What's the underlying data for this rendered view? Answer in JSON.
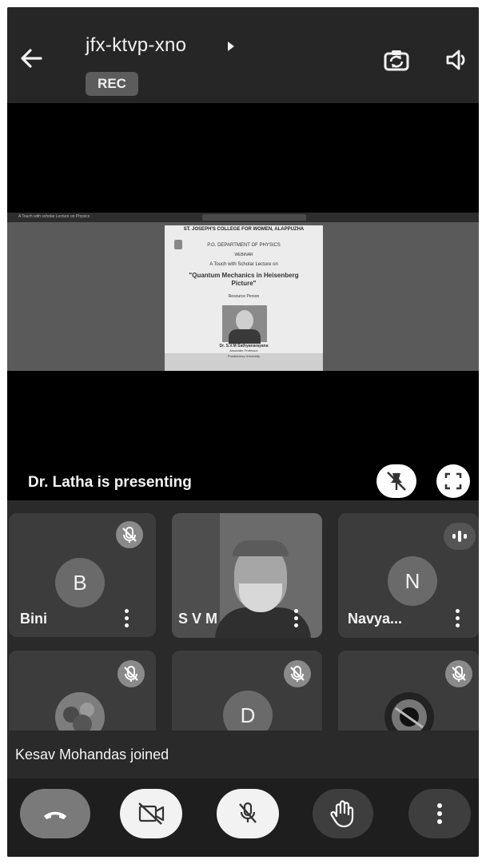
{
  "header": {
    "meeting_code": "jfx-ktvp-xno",
    "rec_badge": "REC",
    "icons": [
      "back-arrow-icon",
      "caret-right-icon",
      "switch-camera-icon",
      "speaker-icon"
    ]
  },
  "stage": {
    "presenting_text": "Dr. Latha is presenting",
    "slide": {
      "tab_text": "A Touch with scholar Lecture on Physics",
      "header": "ST. JOSEPH'S COLLEGE FOR WOMEN, ALAPPUZHA",
      "department": "P.G. DEPARTMENT OF PHYSICS",
      "series": "WEBINAR",
      "event": "A Touch with Scholar Lecture on",
      "topic": "\"Quantum Mechanics in Heisenberg Picture\"",
      "resource_label": "Resource Person",
      "speaker_name": "Dr. S.V.M Sathyanarayana",
      "speaker_role": "Associate Professor",
      "speaker_affiliation": "Pondicherry University"
    }
  },
  "participants": [
    {
      "name": "Bini",
      "initial": "B",
      "muted": true
    },
    {
      "name": "S V M",
      "initial": "",
      "muted": false,
      "video": true
    },
    {
      "name": "Navya...",
      "initial": "N",
      "muted": false,
      "speaking": true
    },
    {
      "name": "",
      "initial": "",
      "muted": true,
      "photo": true
    },
    {
      "name": "",
      "initial": "D",
      "muted": true
    },
    {
      "name": "",
      "initial": "",
      "muted": true,
      "photo": true
    }
  ],
  "toast": {
    "text": "Kesav Mohandas joined"
  },
  "controls": [
    "end-call",
    "camera-off",
    "mic-off",
    "raise-hand",
    "more-options"
  ],
  "colors": {
    "background": "#2a2a2a",
    "tile": "#3c3c3c",
    "avatar": "#6a6a6a",
    "controls_bar": "#1e1e1e"
  }
}
